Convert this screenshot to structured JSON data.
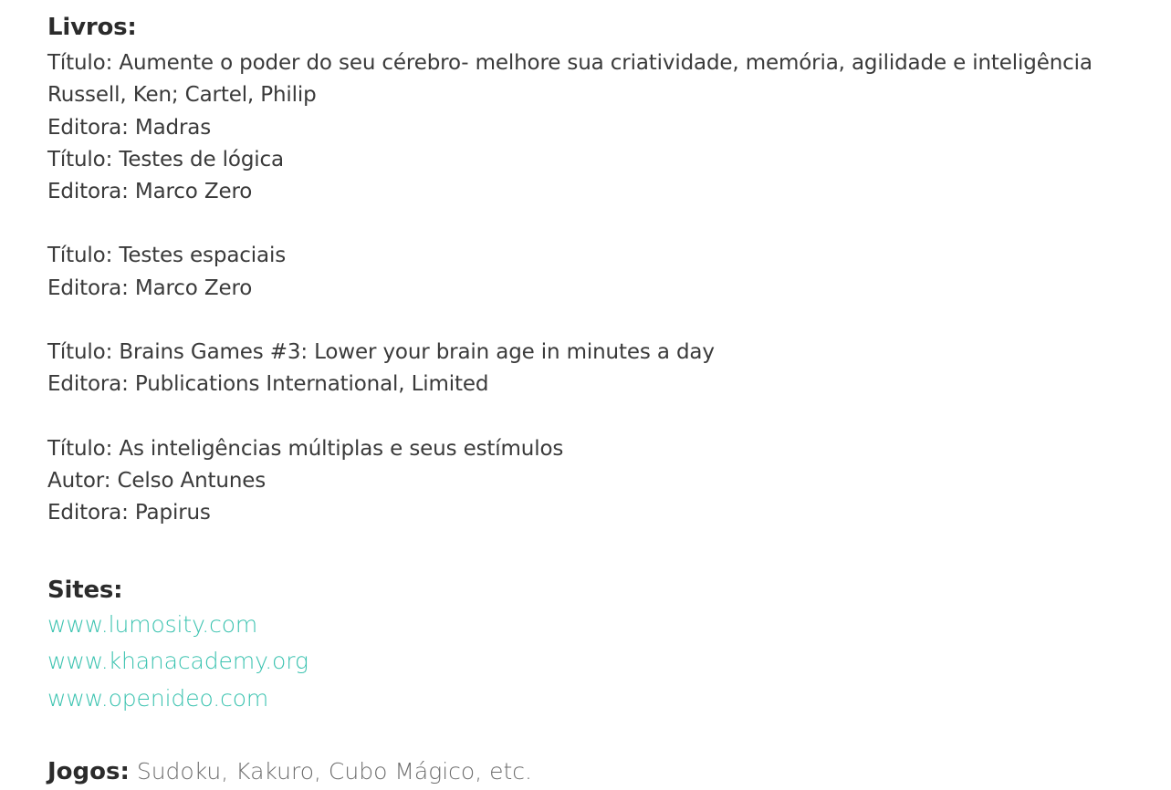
{
  "livros": {
    "heading": "Livros:",
    "groups": [
      {
        "lines": [
          "Título: Aumente o poder do seu cérebro- melhore sua criatividade, memória, agilidade e inteligência",
          "Russell, Ken; Cartel, Philip",
          "Editora: Madras",
          "Título: Testes de lógica",
          "Editora: Marco Zero"
        ]
      },
      {
        "lines": [
          "Título: Testes espaciais",
          "Editora: Marco Zero"
        ]
      },
      {
        "lines": [
          "Título: Brains Games #3: Lower your brain age in minutes a day",
          "Editora: Publications International, Limited"
        ]
      },
      {
        "lines": [
          "Título: As inteligências múltiplas e seus estímulos",
          "Autor: Celso Antunes",
          "Editora: Papirus"
        ]
      }
    ]
  },
  "sites": {
    "heading": "Sites:",
    "links": [
      "www.lumosity.com",
      "www.khanacademy.org",
      "www.openideo.com"
    ]
  },
  "jogos": {
    "label": "Jogos:",
    "text": " Sudoku, Kakuro, Cubo Mágico, etc."
  },
  "colors": {
    "link": "#3cc3b0",
    "text": "#3a3a3a",
    "muted": "#6e6e6e"
  }
}
